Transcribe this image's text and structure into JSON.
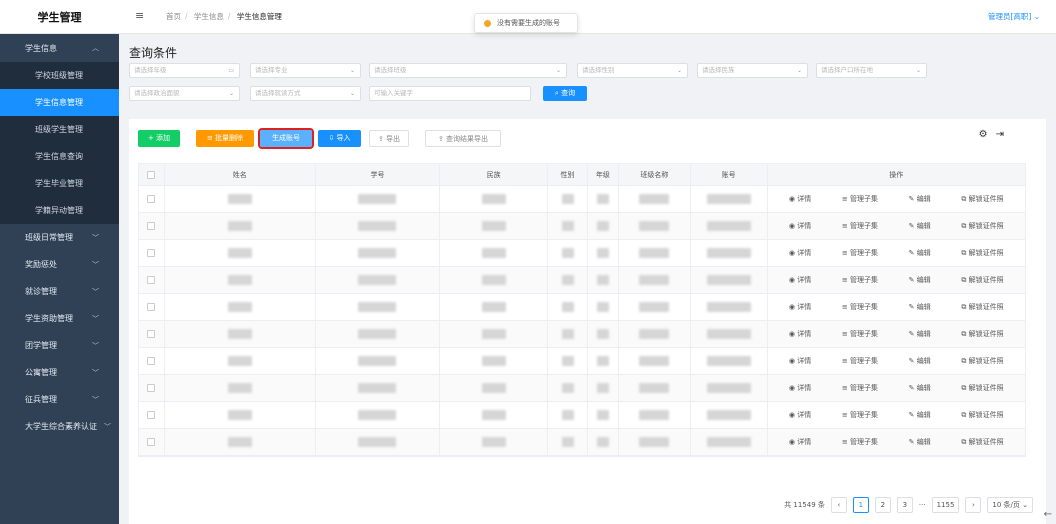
{
  "app": {
    "title": "学生管理"
  },
  "sidebar": {
    "group": "学生信息",
    "sub": [
      "学校班级管理",
      "学生信息管理",
      "班级学生管理",
      "学生信息查询",
      "学生毕业管理",
      "学籍异动管理"
    ],
    "items": [
      "班级日常管理",
      "奖励惩处",
      "就诊管理",
      "学生资助管理",
      "团学管理",
      "公寓管理",
      "征兵管理",
      "大学生综合素养认证"
    ]
  },
  "header": {
    "crumbs": [
      "首页",
      "学生信息",
      "学生信息管理"
    ],
    "user": "管理员[高职]"
  },
  "toast": {
    "text": "没有需要生成的账号",
    "color": "#f5a623"
  },
  "query": {
    "title": "查询条件",
    "placeholders": [
      "请选择年级",
      "请选择专业",
      "请选择班级",
      "请选择性别",
      "请选择民族",
      "请选择户口所在地",
      "请选择政治面貌",
      "请选择就读方式",
      "可输入关键字"
    ],
    "search": "查询"
  },
  "toolbar": {
    "add": "添加",
    "batch_delete": "批量删除",
    "gen_account": "生成账号",
    "import": "导入",
    "export": "导出",
    "query_export": "查询结果导出"
  },
  "table": {
    "headers": [
      "姓名",
      "学号",
      "民族",
      "性别",
      "年级",
      "班级名称",
      "账号",
      "操作"
    ],
    "ops": [
      "详情",
      "管理子集",
      "编辑",
      "解锁证件照"
    ]
  },
  "pager": {
    "total": "共 11549 条",
    "pages": [
      "1",
      "2",
      "3",
      "···",
      "1155"
    ],
    "size": "10 条/页"
  },
  "colors": {
    "primary": "#1890ff",
    "sidebar": "#304156",
    "success": "#13ce66",
    "warning": "#ff9900"
  }
}
